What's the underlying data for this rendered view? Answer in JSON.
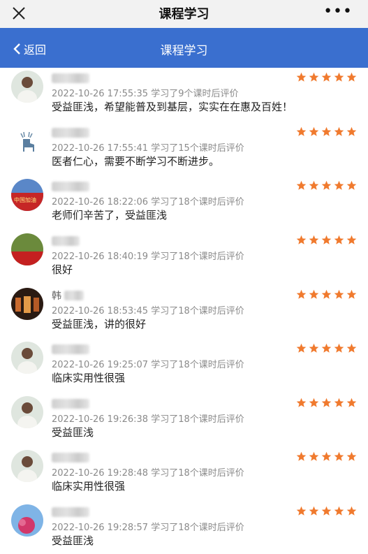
{
  "window": {
    "title": "课程学习"
  },
  "nav": {
    "back_label": "返回",
    "title": "课程学习"
  },
  "accent": "#3a6fcf",
  "star_color": "#f07a2e",
  "reviews": [
    {
      "name_initial": "",
      "meta": "2022-10-26 17:55:35 学习了9个课时后评价",
      "content": "受益匪浅，希望能普及到基层，实实在在惠及百姓！",
      "rating": 5,
      "avatar": "person-photo"
    },
    {
      "name_initial": "",
      "meta": "2022-10-26 17:55:41 学习了15个课时后评价",
      "content": "医者仁心，需要不断学习不断进步。",
      "rating": 5,
      "avatar": "deer-illustration"
    },
    {
      "name_initial": "",
      "meta": "2022-10-26 18:22:06 学习了18个课时后评价",
      "content": "老师们辛苦了，受益匪浅",
      "rating": 5,
      "avatar": "china-flag-photo"
    },
    {
      "name_initial": "",
      "meta": "2022-10-26 18:40:19 学习了18个课时后评价",
      "content": "很好",
      "rating": 5,
      "avatar": "banner-photo"
    },
    {
      "name_initial": "韩",
      "meta": "2022-10-26 18:53:45 学习了18个课时后评价",
      "content": "受益匪浅，讲的很好",
      "rating": 5,
      "avatar": "dark-photo"
    },
    {
      "name_initial": "",
      "meta": "2022-10-26 19:25:07 学习了18个课时后评价",
      "content": "临床实用性很强",
      "rating": 5,
      "avatar": "person-photo"
    },
    {
      "name_initial": "",
      "meta": "2022-10-26 19:26:38 学习了18个课时后评价",
      "content": "受益匪浅",
      "rating": 5,
      "avatar": "person-photo"
    },
    {
      "name_initial": "",
      "meta": "2022-10-26 19:28:48 学习了18个课时后评价",
      "content": "临床实用性很强",
      "rating": 5,
      "avatar": "person-photo"
    },
    {
      "name_initial": "",
      "meta": "2022-10-26 19:28:57 学习了18个课时后评价",
      "content": "受益匪浅",
      "rating": 5,
      "avatar": "flower-photo"
    }
  ]
}
